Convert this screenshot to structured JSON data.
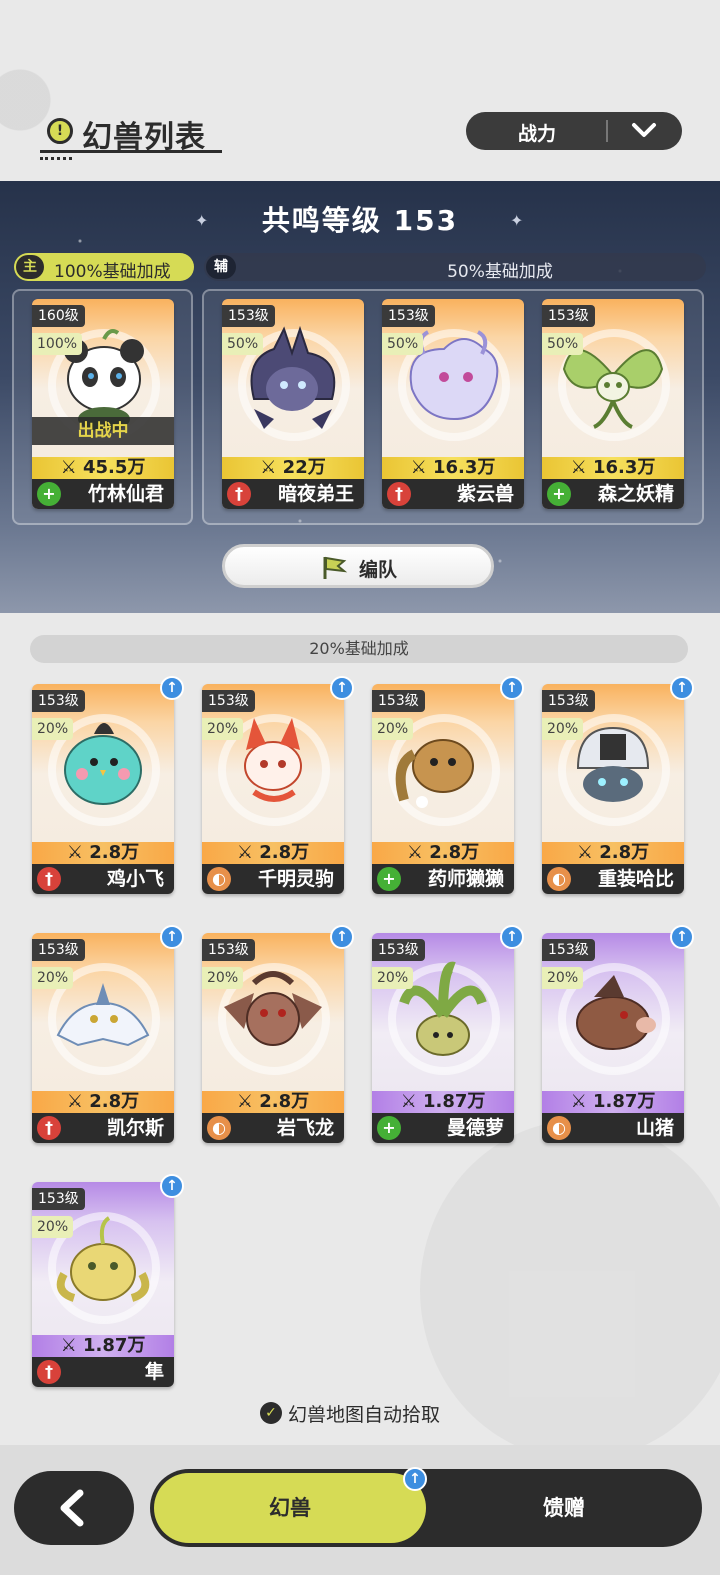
{
  "header": {
    "title": "幻兽列表",
    "title_icon": "!",
    "sort": {
      "selected": "战力"
    }
  },
  "resonance": {
    "title": "共鸣等级 153",
    "main": {
      "tag": "主",
      "bonus": "100%基础加成"
    },
    "sub": {
      "tag": "辅",
      "bonus": "50%基础加成"
    },
    "formation_button": "编队"
  },
  "team": [
    {
      "level": "160级",
      "pct": "100%",
      "power": "45.5万",
      "name": "竹林仙君",
      "type": "heal",
      "status": "出战中"
    },
    {
      "level": "153级",
      "pct": "50%",
      "power": "22万",
      "name": "暗夜弟王",
      "type": "attack"
    },
    {
      "level": "153级",
      "pct": "50%",
      "power": "16.3万",
      "name": "紫云兽",
      "type": "attack"
    },
    {
      "level": "153级",
      "pct": "50%",
      "power": "16.3万",
      "name": "森之妖精",
      "type": "heal"
    }
  ],
  "others_bonus": "20%基础加成",
  "others": [
    {
      "level": "153级",
      "pct": "20%",
      "power": "2.8万",
      "name": "鸡小飞",
      "type": "attack",
      "rarity": "orange"
    },
    {
      "level": "153级",
      "pct": "20%",
      "power": "2.8万",
      "name": "千明灵驹",
      "type": "defense",
      "rarity": "orange"
    },
    {
      "level": "153级",
      "pct": "20%",
      "power": "2.8万",
      "name": "药师獭獭",
      "type": "heal",
      "rarity": "orange"
    },
    {
      "level": "153级",
      "pct": "20%",
      "power": "2.8万",
      "name": "重装哈比",
      "type": "defense",
      "rarity": "orange"
    },
    {
      "level": "153级",
      "pct": "20%",
      "power": "2.8万",
      "name": "凯尔斯",
      "type": "attack",
      "rarity": "orange"
    },
    {
      "level": "153级",
      "pct": "20%",
      "power": "2.8万",
      "name": "岩飞龙",
      "type": "defense",
      "rarity": "orange"
    },
    {
      "level": "153级",
      "pct": "20%",
      "power": "1.87万",
      "name": "曼德萝",
      "type": "heal",
      "rarity": "purple"
    },
    {
      "level": "153级",
      "pct": "20%",
      "power": "1.87万",
      "name": "山猪",
      "type": "defense",
      "rarity": "purple"
    },
    {
      "level": "153级",
      "pct": "20%",
      "power": "1.87万",
      "name": "隼",
      "type": "attack",
      "rarity": "purple"
    }
  ],
  "auto_pickup": "幻兽地图自动拾取",
  "tabs": {
    "beast": "幻兽",
    "gift": "馈赠"
  },
  "icons": {
    "attack": "sword-icon",
    "heal": "plus-icon",
    "defense": "shield-icon",
    "power": "crossed-swords-icon",
    "upgrade": "arrow-up-icon"
  },
  "colors": {
    "accent": "#d6db55",
    "dark": "#2c2c2c",
    "upgrade": "#3d8ee0"
  }
}
